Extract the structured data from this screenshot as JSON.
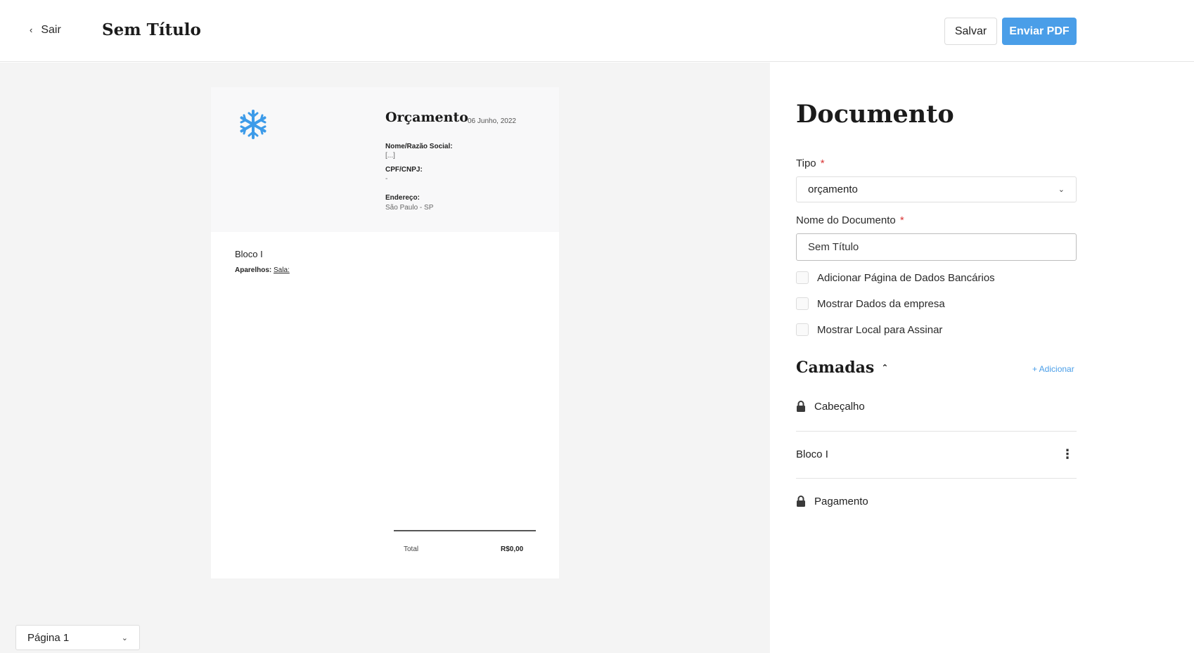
{
  "header": {
    "back_label": "Sair",
    "document_title": "Sem Título",
    "save_label": "Salvar",
    "send_pdf_label": "Enviar PDF",
    "accent_color": "#4a9ee8"
  },
  "preview": {
    "quote_title": "Orçamento",
    "quote_date": "06 Junho, 2022",
    "name_label": "Nome/Razão Social:",
    "name_value": "[...]",
    "doc_label": "CPF/CNPJ:",
    "doc_value": "-",
    "address_label": "Endereço:",
    "address_value": "São Paulo - SP",
    "block_title": "Bloco I",
    "devices_label": "Aparelhos:",
    "devices_value": "Sala:",
    "total_label": "Total",
    "total_value": "R$0,00",
    "logo_icon": "snowflake-icon"
  },
  "page_selector": {
    "value": "Página 1"
  },
  "panel": {
    "title": "Documento",
    "type_label": "Tipo",
    "type_value": "orçamento",
    "name_label": "Nome do Documento",
    "name_value": "Sem Título",
    "required_mark": "*",
    "checkboxes": [
      {
        "label": "Adicionar Página de Dados Bancários",
        "checked": false
      },
      {
        "label": "Mostrar Dados da empresa",
        "checked": false
      },
      {
        "label": "Mostrar Local para Assinar",
        "checked": false
      }
    ],
    "layers_title": "Camadas",
    "add_label": "+ Adicionar",
    "layers": [
      {
        "label": "Cabeçalho",
        "locked": true
      },
      {
        "label": "Bloco I",
        "locked": false
      },
      {
        "label": "Pagamento",
        "locked": true
      }
    ]
  }
}
